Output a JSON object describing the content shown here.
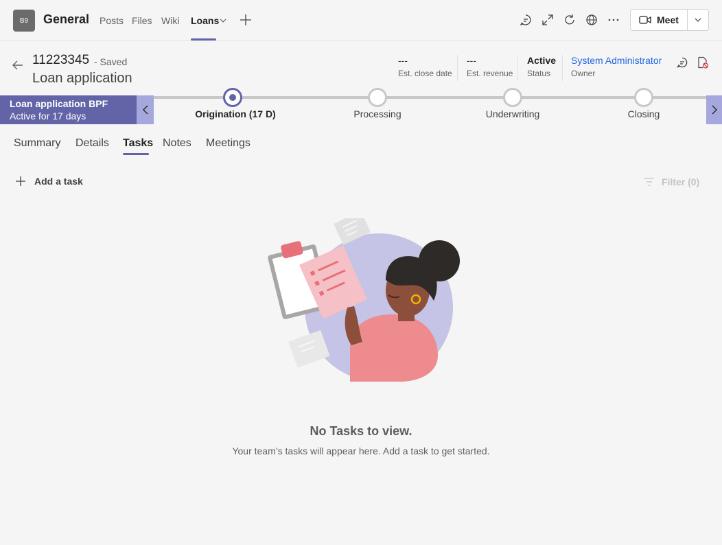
{
  "topbar": {
    "team_initials": "B9",
    "channel_name": "General",
    "tabs": [
      "Posts",
      "Files",
      "Wiki",
      "Loans"
    ],
    "active_tab": "Loans",
    "meet_label": "Meet"
  },
  "record": {
    "id": "11223345",
    "saved": "- Saved",
    "title": "Loan application",
    "fields": [
      {
        "value": "---",
        "label": "Est. close date"
      },
      {
        "value": "---",
        "label": "Est. revenue"
      },
      {
        "value": "Active",
        "label": "Status"
      },
      {
        "value": "System Administrator",
        "label": "Owner"
      }
    ]
  },
  "bpf": {
    "name": "Loan application BPF",
    "status": "Active for 17 days",
    "stages": [
      {
        "label": "Origination  (17 D)",
        "active": true
      },
      {
        "label": "Processing",
        "active": false
      },
      {
        "label": "Underwriting",
        "active": false
      },
      {
        "label": "Closing",
        "active": false
      }
    ]
  },
  "record_tabs": [
    "Summary",
    "Details",
    "Tasks",
    "Notes",
    "Meetings"
  ],
  "active_record_tab": "Tasks",
  "tasks": {
    "add_label": "Add a task",
    "filter_label": "Filter (0)",
    "empty_title": "No Tasks to view.",
    "empty_subtitle": "Your team’s tasks will appear here. Add a task to get started."
  },
  "colors": {
    "accent": "#6264a7",
    "accent_light": "#a6a7dc",
    "link": "#2266e3"
  },
  "icons": [
    "chat-icon",
    "expand-icon",
    "refresh-icon",
    "globe-icon",
    "more-icon",
    "video-icon",
    "chevron-down-icon",
    "back-arrow-icon",
    "chat-bubble-icon",
    "document-forbidden-icon",
    "chevron-left-icon",
    "chevron-right-icon",
    "plus-icon",
    "filter-icon"
  ]
}
